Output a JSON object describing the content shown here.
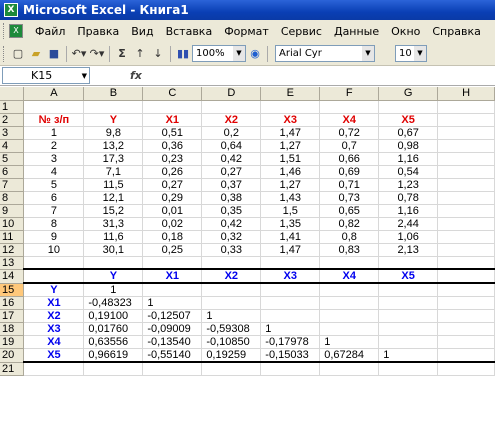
{
  "window": {
    "title": "Microsoft Excel - Книга1"
  },
  "menu": [
    "Файл",
    "Правка",
    "Вид",
    "Вставка",
    "Формат",
    "Сервис",
    "Данные",
    "Окно",
    "Справка"
  ],
  "toolbar": {
    "zoom": "100%",
    "sigma": "Σ",
    "font": "Arial Cyr",
    "size": "10"
  },
  "formula_bar": {
    "name_box": "K15",
    "fx": "fx",
    "value": ""
  },
  "columns": [
    "A",
    "B",
    "C",
    "D",
    "E",
    "F",
    "G",
    "H"
  ],
  "rows": [
    {
      "n": "1",
      "cells": [
        "",
        "",
        "",
        "",
        "",
        "",
        ""
      ]
    },
    {
      "n": "2",
      "cells": [
        "№ з/п",
        "Y",
        "X1",
        "X2",
        "X3",
        "X4",
        "X5"
      ]
    },
    {
      "n": "3",
      "cells": [
        "1",
        "9,8",
        "0,51",
        "0,2",
        "1,47",
        "0,72",
        "0,67"
      ]
    },
    {
      "n": "4",
      "cells": [
        "2",
        "13,2",
        "0,36",
        "0,64",
        "1,27",
        "0,7",
        "0,98"
      ]
    },
    {
      "n": "5",
      "cells": [
        "3",
        "17,3",
        "0,23",
        "0,42",
        "1,51",
        "0,66",
        "1,16"
      ]
    },
    {
      "n": "6",
      "cells": [
        "4",
        "7,1",
        "0,26",
        "0,27",
        "1,46",
        "0,69",
        "0,54"
      ]
    },
    {
      "n": "7",
      "cells": [
        "5",
        "11,5",
        "0,27",
        "0,37",
        "1,27",
        "0,71",
        "1,23"
      ]
    },
    {
      "n": "8",
      "cells": [
        "6",
        "12,1",
        "0,29",
        "0,38",
        "1,43",
        "0,73",
        "0,78"
      ]
    },
    {
      "n": "9",
      "cells": [
        "7",
        "15,2",
        "0,01",
        "0,35",
        "1,5",
        "0,65",
        "1,16"
      ]
    },
    {
      "n": "10",
      "cells": [
        "8",
        "31,3",
        "0,02",
        "0,42",
        "1,35",
        "0,82",
        "2,44"
      ]
    },
    {
      "n": "11",
      "cells": [
        "9",
        "11,6",
        "0,18",
        "0,32",
        "1,41",
        "0,8",
        "1,06"
      ]
    },
    {
      "n": "12",
      "cells": [
        "10",
        "30,1",
        "0,25",
        "0,33",
        "1,47",
        "0,83",
        "2,13"
      ]
    },
    {
      "n": "13",
      "cells": [
        "",
        "",
        "",
        "",
        "",
        "",
        ""
      ]
    },
    {
      "n": "14",
      "cells": [
        "",
        "Y",
        "X1",
        "X2",
        "X3",
        "X4",
        "X5"
      ]
    },
    {
      "n": "15",
      "cells": [
        "Y",
        "1",
        "",
        "",
        "",
        "",
        ""
      ]
    },
    {
      "n": "16",
      "cells": [
        "X1",
        "-0,48323",
        "1",
        "",
        "",
        "",
        ""
      ]
    },
    {
      "n": "17",
      "cells": [
        "X2",
        "0,19100",
        "-0,12507",
        "1",
        "",
        "",
        ""
      ]
    },
    {
      "n": "18",
      "cells": [
        "X3",
        "0,01760",
        "-0,09009",
        "-0,59308",
        "1",
        "",
        ""
      ]
    },
    {
      "n": "19",
      "cells": [
        "X4",
        "0,63556",
        "-0,13540",
        "-0,10850",
        "-0,17978",
        "1",
        ""
      ]
    },
    {
      "n": "20",
      "cells": [
        "X5",
        "0,96619",
        "-0,55140",
        "0,19259",
        "-0,15033",
        "0,67284",
        "1"
      ]
    },
    {
      "n": "21",
      "cells": [
        "",
        "",
        "",
        "",
        "",
        "",
        ""
      ]
    }
  ]
}
